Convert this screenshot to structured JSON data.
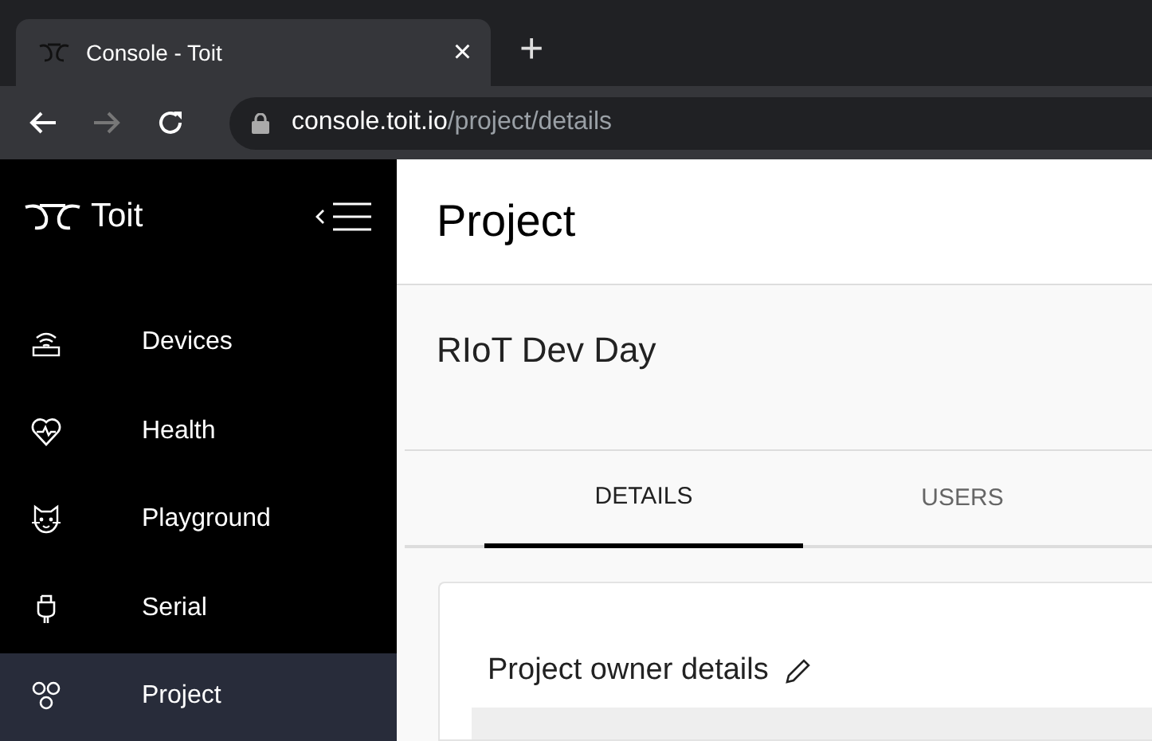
{
  "browser": {
    "tab_title": "Console - Toit",
    "new_tab": "+",
    "close": "×",
    "url_host": "console.toit.io",
    "url_path": "/project/details"
  },
  "sidebar": {
    "brand": "Toit",
    "items": [
      {
        "label": "Devices",
        "selected": false
      },
      {
        "label": "Health",
        "selected": false
      },
      {
        "label": "Playground",
        "selected": false
      },
      {
        "label": "Serial",
        "selected": false
      },
      {
        "label": "Project",
        "selected": true
      }
    ]
  },
  "page": {
    "title": "Project",
    "project_name": "RIoT Dev Day",
    "tabs": [
      {
        "label": "DETAILS",
        "selected": true
      },
      {
        "label": "USERS",
        "selected": false
      }
    ],
    "card": {
      "heading": "Project owner details"
    }
  }
}
